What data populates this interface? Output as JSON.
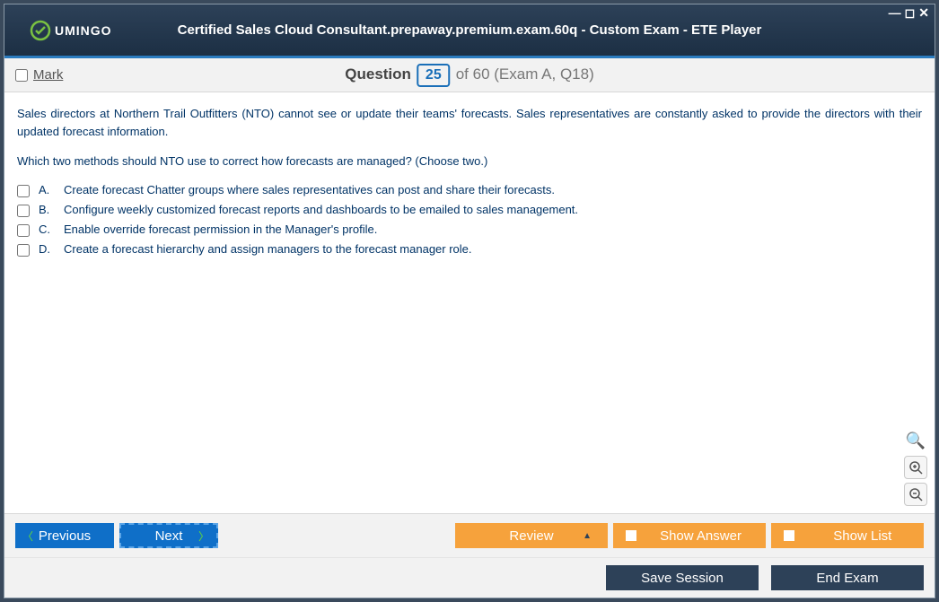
{
  "window": {
    "logo_text": "UMINGO",
    "title": "Certified Sales Cloud Consultant.prepaway.premium.exam.60q - Custom Exam - ETE Player"
  },
  "questionbar": {
    "mark_label": "Mark",
    "question_label": "Question",
    "current": "25",
    "total_text": "of 60 (Exam A, Q18)"
  },
  "question": {
    "para1": "Sales directors at Northern Trail Outfitters (NTO) cannot see or update their teams' forecasts. Sales representatives are constantly asked to provide the directors with their updated forecast information.",
    "para2": "Which two methods should NTO use to correct how forecasts are managed? (Choose two.)",
    "options": [
      {
        "letter": "A.",
        "text": "Create forecast Chatter groups where sales representatives can post and share their forecasts."
      },
      {
        "letter": "B.",
        "text": "Configure weekly customized forecast reports and dashboards to be emailed to sales management."
      },
      {
        "letter": "C.",
        "text": "Enable override forecast permission in the Manager's profile."
      },
      {
        "letter": "D.",
        "text": "Create a forecast hierarchy and assign managers to the forecast manager role."
      }
    ]
  },
  "buttons": {
    "previous": "Previous",
    "next": "Next",
    "review": "Review",
    "show_answer": "Show Answer",
    "show_list": "Show List",
    "save_session": "Save Session",
    "end_exam": "End Exam"
  }
}
